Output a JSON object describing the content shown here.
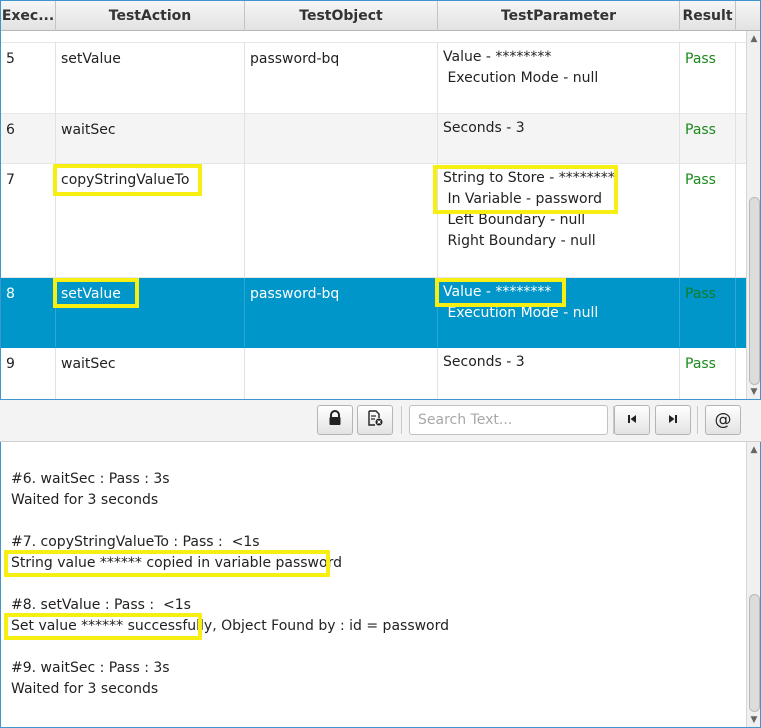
{
  "table": {
    "columns": [
      "Exec...",
      "TestAction",
      "TestObject",
      "TestParameter",
      "Result"
    ],
    "rows": [
      {
        "num": "5",
        "action": "setValue",
        "object": "password-bq",
        "params": [
          "Value - ********",
          " Execution Mode - null"
        ],
        "result": "Pass"
      },
      {
        "num": "6",
        "action": "waitSec",
        "object": "",
        "params": [
          "Seconds - 3"
        ],
        "result": "Pass"
      },
      {
        "num": "7",
        "action": "copyStringValueTo",
        "object": "",
        "params": [
          "String to Store - ********",
          " In Variable - password",
          " Left Boundary - null",
          " Right Boundary - null"
        ],
        "result": "Pass"
      },
      {
        "num": "8",
        "action": "setValue",
        "object": "password-bq",
        "params": [
          "Value - ********",
          " Execution Mode - null"
        ],
        "result": "Pass"
      },
      {
        "num": "9",
        "action": "waitSec",
        "object": "",
        "params": [
          "Seconds - 3"
        ],
        "result": "Pass"
      }
    ]
  },
  "toolbar": {
    "search_placeholder": "Search Text...",
    "lock_icon": "lock-icon",
    "clear_icon": "clear-log-icon",
    "prev_icon": "skip-previous-icon",
    "next_icon": "skip-next-icon",
    "at_label": "@"
  },
  "console": {
    "lines": [
      "#6. waitSec : Pass : 3s",
      "Waited for 3 seconds",
      "",
      "#7. copyStringValueTo : Pass :  <1s",
      "String value ****** copied in variable password",
      "",
      "#8. setValue : Pass :  <1s",
      "Set value ****** successfully, Object Found by : id = password",
      "",
      "#9. waitSec : Pass : 3s",
      "Waited for 3 seconds"
    ]
  },
  "colors": {
    "selection": "#0096c9",
    "pass": "#1a8a1a",
    "highlight": "#f7ee12"
  }
}
